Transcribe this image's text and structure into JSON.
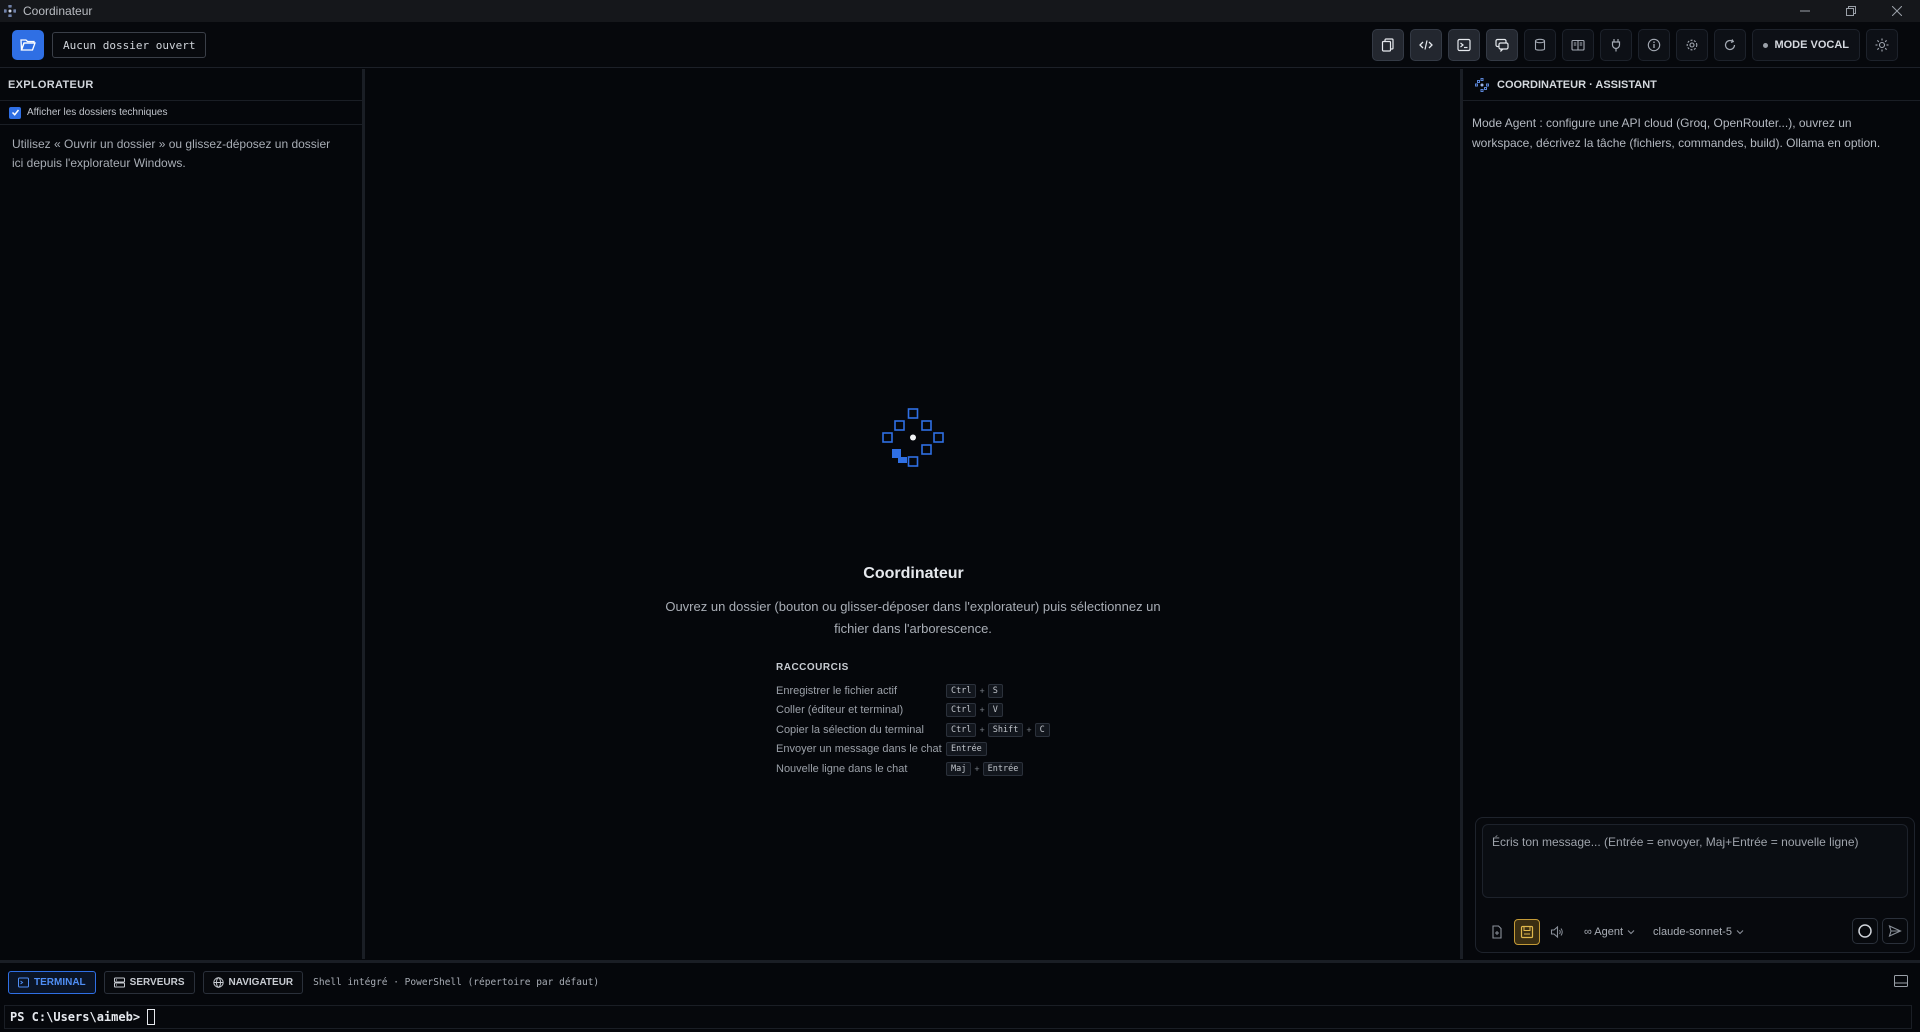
{
  "window": {
    "title": "Coordinateur"
  },
  "toolbar": {
    "folder_label": "Aucun dossier ouvert",
    "tools": [
      "copy-icon",
      "code-icon",
      "terminal-icon",
      "chat-icon",
      "database-icon",
      "book-icon",
      "plug-icon",
      "info-icon",
      "gear-icon",
      "refresh-icon"
    ],
    "active_tools": [
      "code-icon",
      "terminal-icon",
      "chat-icon"
    ],
    "vocal_label": "MODE VOCAL"
  },
  "explorer": {
    "title": "EXPLORATEUR",
    "show_technical_label": "Afficher les dossiers techniques",
    "show_technical_checked": true,
    "help": "Utilisez « Ouvrir un dossier » ou glissez-déposez un dossier ici depuis l'explorateur Windows."
  },
  "welcome": {
    "title": "Coordinateur",
    "subtitle": "Ouvrez un dossier (bouton ou glisser-déposer dans l'explorateur) puis sélectionnez un fichier dans l'arborescence.",
    "shortcuts_title": "RACCOURCIS",
    "shortcuts": [
      {
        "label": "Enregistrer le fichier actif",
        "keys": [
          "Ctrl",
          "S"
        ]
      },
      {
        "label": "Coller (éditeur et terminal)",
        "keys": [
          "Ctrl",
          "V"
        ]
      },
      {
        "label": "Copier la sélection du terminal",
        "keys": [
          "Ctrl",
          "Shift",
          "C"
        ]
      },
      {
        "label": "Envoyer un message dans le chat",
        "keys": [
          "Entrée"
        ]
      },
      {
        "label": "Nouvelle ligne dans le chat",
        "keys": [
          "Maj",
          "Entrée"
        ]
      }
    ]
  },
  "assistant": {
    "title": "COORDINATEUR · ASSISTANT",
    "message": "Mode Agent : configure une API cloud (Groq, OpenRouter...), ouvrez un workspace, décrivez la tâche (fichiers, commandes, build). Ollama en option.",
    "placeholder": "Écris ton message... (Entrée = envoyer, Maj+Entrée = nouvelle ligne)",
    "mode": "∞ Agent",
    "model": "claude-sonnet-5"
  },
  "bottom": {
    "tabs": [
      {
        "label": "TERMINAL",
        "icon": "terminal-icon",
        "active": true
      },
      {
        "label": "SERVEURS",
        "icon": "server-icon",
        "active": false
      },
      {
        "label": "NAVIGATEUR",
        "icon": "globe-icon",
        "active": false
      }
    ],
    "shell_info": "Shell intégré · PowerShell (répertoire par défaut)",
    "prompt": "PS C:\\Users\\aimeb>"
  },
  "colors": {
    "accent": "#2f6fe4",
    "background": "#05070b",
    "highlight": "#c39a37"
  }
}
